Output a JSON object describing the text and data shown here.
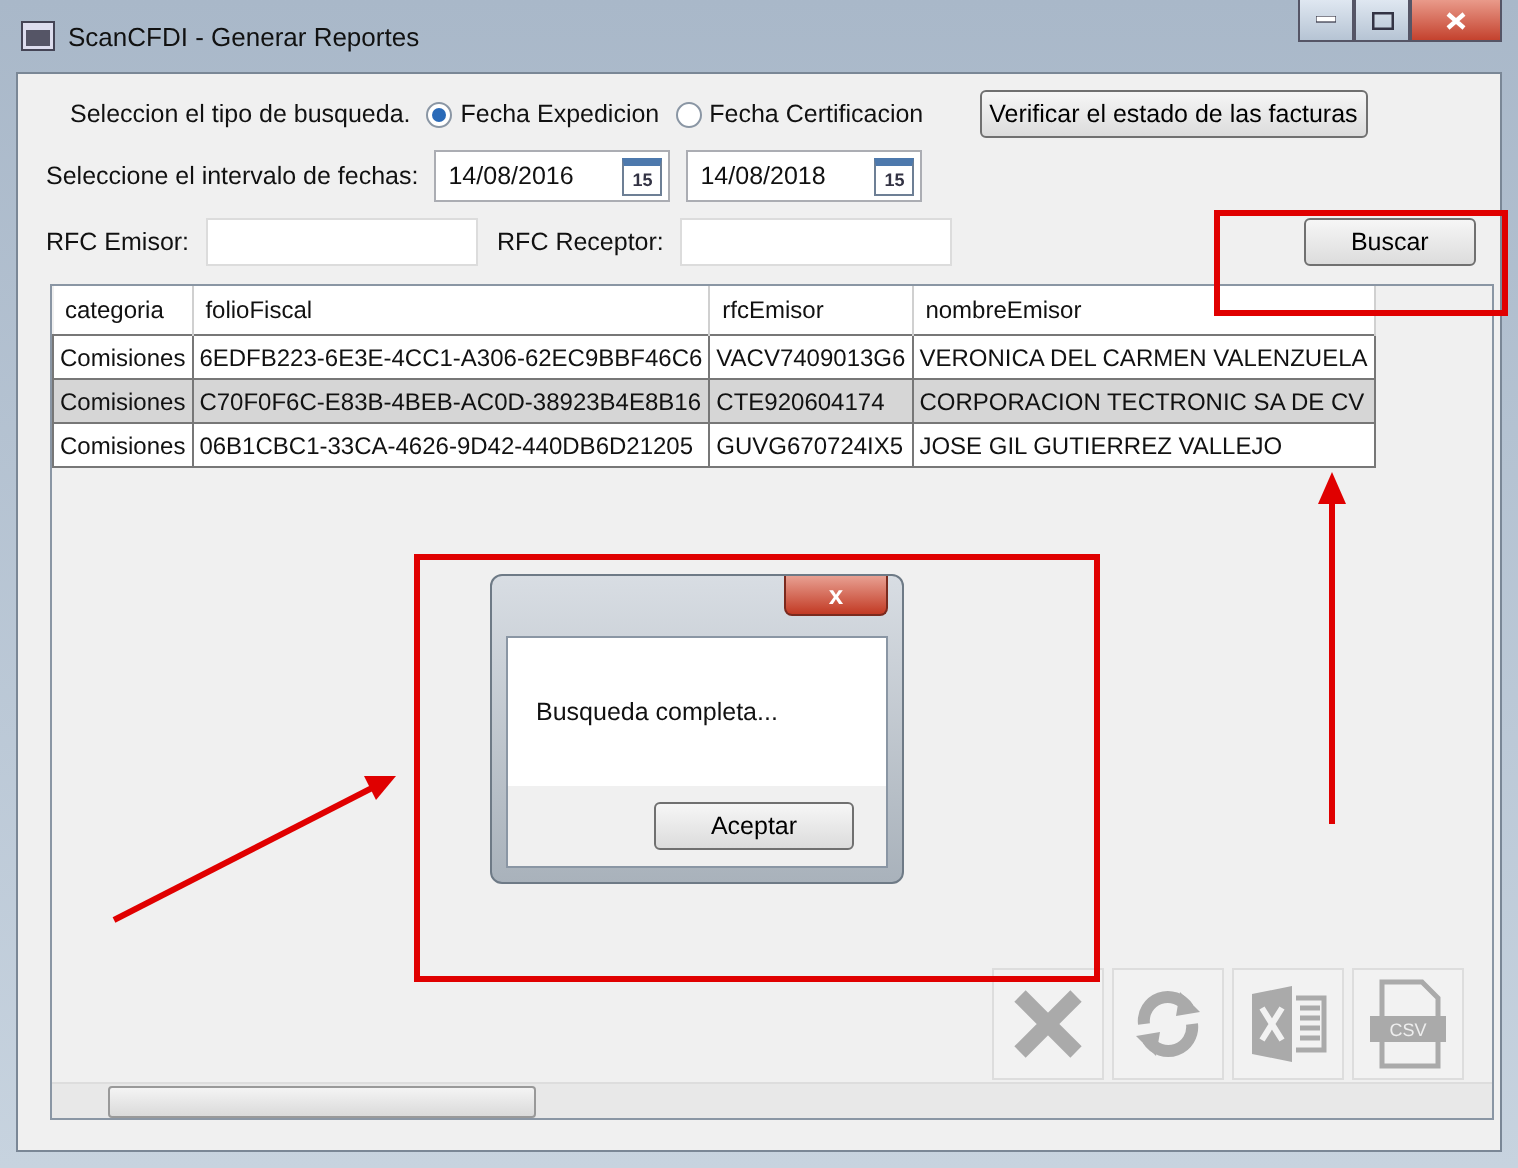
{
  "window": {
    "title": "ScanCFDI - Generar Reportes"
  },
  "search_type": {
    "label": "Seleccion el tipo de busqueda.",
    "options": [
      {
        "label": "Fecha Expedicion",
        "selected": true
      },
      {
        "label": "Fecha Certificacion",
        "selected": false
      }
    ]
  },
  "verify_button": "Verificar el estado de las facturas",
  "date_range": {
    "label": "Seleccione el intervalo de fechas:",
    "from": "14/08/2016",
    "to": "14/08/2018",
    "from_calendar_day": "15",
    "to_calendar_day": "15"
  },
  "rfc_emisor": {
    "label": "RFC Emisor:"
  },
  "rfc_receptor": {
    "label": "RFC Receptor:"
  },
  "search_button": "Buscar",
  "table": {
    "columns": [
      "categoria",
      "folioFiscal",
      "rfcEmisor",
      "nombreEmisor"
    ],
    "rows": [
      {
        "cells": [
          "Comisiones",
          "6EDFB223-6E3E-4CC1-A306-62EC9BBF46C6",
          "VACV7409013G6",
          "VERONICA DEL CARMEN VALENZUELA"
        ],
        "selected": false
      },
      {
        "cells": [
          "Comisiones",
          "C70F0F6C-E83B-4BEB-AC0D-38923B4E8B16",
          "CTE920604174",
          "CORPORACION TECTRONIC SA DE CV"
        ],
        "selected": true
      },
      {
        "cells": [
          "Comisiones",
          "06B1CBC1-33CA-4626-9D42-440DB6D21205",
          "GUVG670724IX5",
          "JOSE GIL GUTIERREZ VALLEJO"
        ],
        "selected": false
      }
    ]
  },
  "toolbar": {
    "csv_label": "CSV"
  },
  "dialog": {
    "close": "x",
    "message": "Busqueda completa...",
    "button": "Aceptar"
  }
}
